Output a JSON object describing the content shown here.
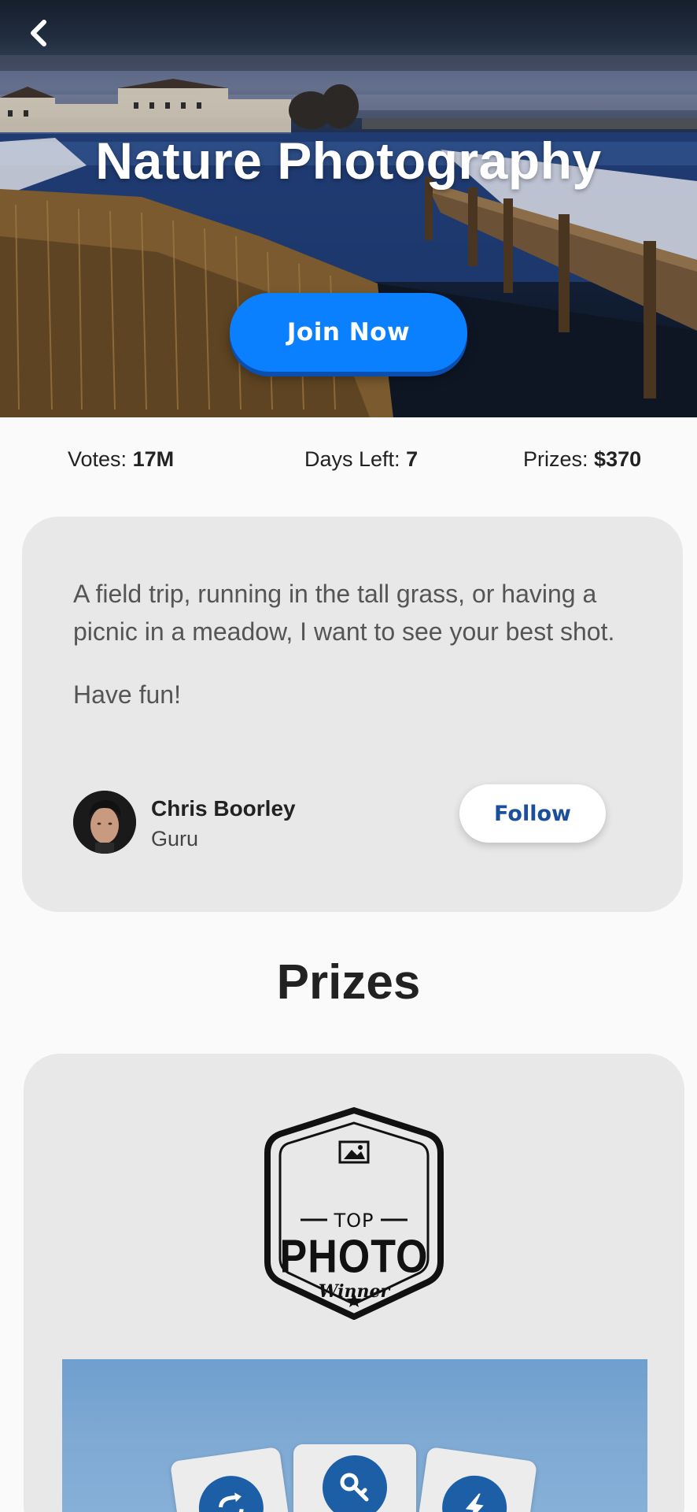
{
  "hero": {
    "title": "Nature Photography",
    "join_label": "Join Now",
    "back_icon": "chevron-left-icon"
  },
  "stats": {
    "votes_label": "Votes:",
    "votes_value": "17M",
    "days_label": "Days Left:",
    "days_value": "7",
    "prizes_label": "Prizes:",
    "prizes_value": "$370"
  },
  "description": {
    "text": "A field trip, running in the tall grass, or having a picnic in a meadow, I want to see your best shot.",
    "closing": "Have fun!"
  },
  "author": {
    "name": "Chris Boorley",
    "role": "Guru",
    "follow_label": "Follow"
  },
  "prizes": {
    "heading": "Prizes",
    "badge": {
      "top": "TOP",
      "photo": "PHOTO",
      "winner": "Winner"
    }
  },
  "colors": {
    "accent": "#0a80ff",
    "follow_text": "#1b4f9c",
    "card_bg": "#e8e8e8",
    "icon_blue": "#1d5fa6"
  }
}
